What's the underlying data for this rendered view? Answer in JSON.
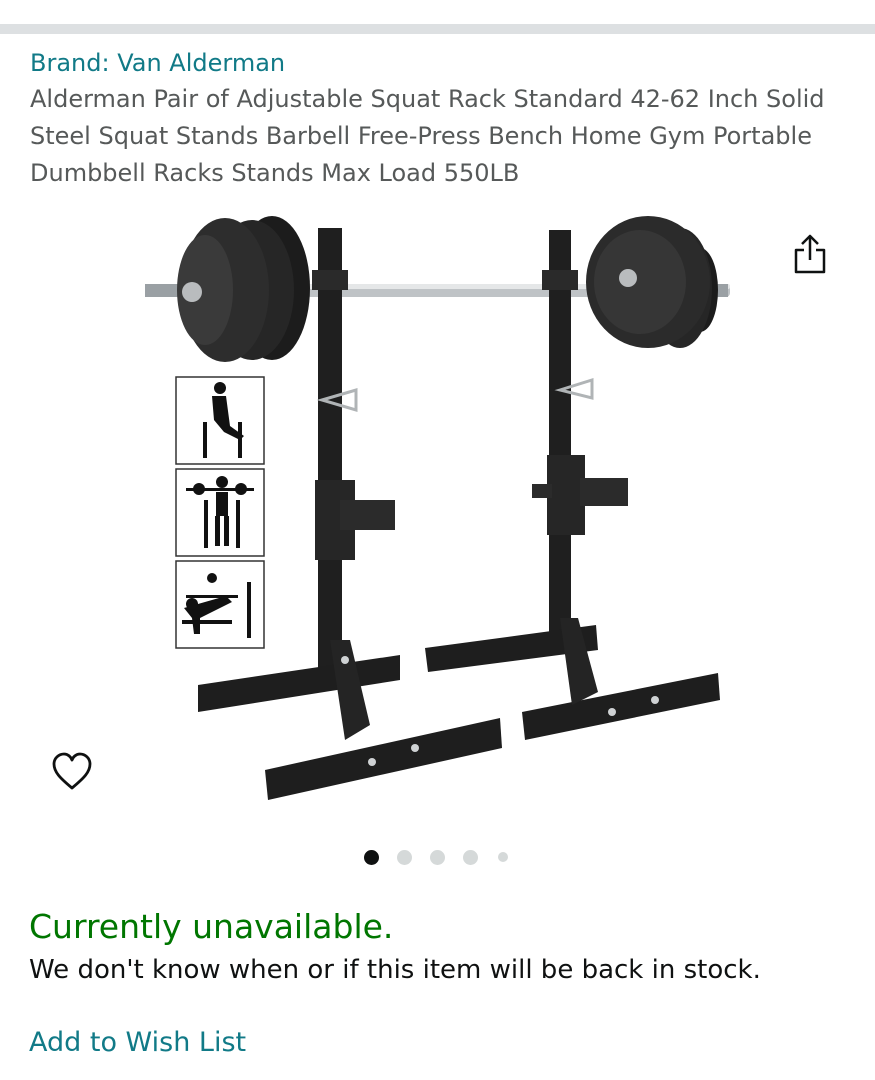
{
  "product": {
    "brand_link": "Brand: Van Alderman",
    "title": "Alderman Pair of Adjustable Squat Rack Standard 42-62 Inch Solid Steel Squat Stands Barbell Free-Press Bench Home Gym Portable Dumbbell Racks Stands Max Load 550LB",
    "image_alt": "Pair of adjustable squat rack stands with loaded barbell",
    "image_count": 5,
    "active_image_index": 1
  },
  "availability": {
    "status": "Currently unavailable.",
    "message": "We don't know when or if this item will be back in stock."
  },
  "actions": {
    "wish_list_label": "Add to Wish List"
  },
  "icons": {
    "share": "share-icon",
    "favorite": "heart-icon"
  },
  "colors": {
    "link": "#117a87",
    "available_status": "#007600",
    "title_text": "#565959",
    "dot_active": "#0f1111",
    "dot_inactive": "#d5d9d9"
  }
}
